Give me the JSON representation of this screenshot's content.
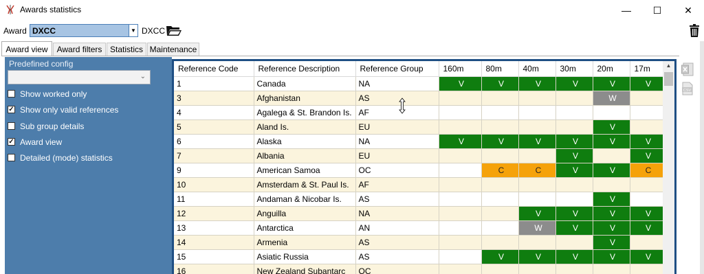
{
  "window": {
    "title": "Awards statistics",
    "minimize": "—",
    "maximize": "☐",
    "close": "✕"
  },
  "toolbar": {
    "award_label": "Award",
    "award_value": "DXCC",
    "award_suffix": "DXCC"
  },
  "tabs": [
    {
      "label": "Award view",
      "active": true
    },
    {
      "label": "Award filters",
      "active": false
    },
    {
      "label": "Statistics",
      "active": false
    },
    {
      "label": "Maintenance",
      "active": false
    }
  ],
  "left_panel": {
    "predefined_label": "Predefined config",
    "predefined_value": "",
    "options": [
      {
        "label": "Show worked only",
        "checked": false
      },
      {
        "label": "Show only valid references",
        "checked": true
      },
      {
        "label": "Sub group details",
        "checked": false
      },
      {
        "label": "Award view",
        "checked": true
      },
      {
        "label": "Detailed (mode) statistics",
        "checked": false
      }
    ]
  },
  "grid": {
    "columns": [
      "Reference Code",
      "Reference Description",
      "Reference Group",
      "160m",
      "80m",
      "40m",
      "30m",
      "20m",
      "17m"
    ],
    "rows": [
      {
        "code": "1",
        "desc": "Canada",
        "group": "NA",
        "marks": [
          "V",
          "V",
          "V",
          "V",
          "V",
          "V"
        ]
      },
      {
        "code": "3",
        "desc": "Afghanistan",
        "group": "AS",
        "marks": [
          "",
          "",
          "",
          "",
          "W",
          ""
        ]
      },
      {
        "code": "4",
        "desc": "Agalega & St. Brandon Is.",
        "group": "AF",
        "marks": [
          "",
          "",
          "",
          "",
          "",
          ""
        ]
      },
      {
        "code": "5",
        "desc": "Aland Is.",
        "group": "EU",
        "marks": [
          "",
          "",
          "",
          "",
          "V",
          ""
        ]
      },
      {
        "code": "6",
        "desc": "Alaska",
        "group": "NA",
        "marks": [
          "V",
          "V",
          "V",
          "V",
          "V",
          "V"
        ]
      },
      {
        "code": "7",
        "desc": "Albania",
        "group": "EU",
        "marks": [
          "",
          "",
          "",
          "V",
          "",
          "V"
        ]
      },
      {
        "code": "9",
        "desc": "American Samoa",
        "group": "OC",
        "marks": [
          "",
          "C",
          "C",
          "V",
          "V",
          "C"
        ]
      },
      {
        "code": "10",
        "desc": "Amsterdam & St. Paul Is.",
        "group": "AF",
        "marks": [
          "",
          "",
          "",
          "",
          "",
          ""
        ]
      },
      {
        "code": "11",
        "desc": "Andaman & Nicobar Is.",
        "group": "AS",
        "marks": [
          "",
          "",
          "",
          "",
          "V",
          ""
        ]
      },
      {
        "code": "12",
        "desc": "Anguilla",
        "group": "NA",
        "marks": [
          "",
          "",
          "V",
          "V",
          "V",
          "V"
        ]
      },
      {
        "code": "13",
        "desc": "Antarctica",
        "group": "AN",
        "marks": [
          "",
          "",
          "W",
          "V",
          "V",
          "V"
        ]
      },
      {
        "code": "14",
        "desc": "Armenia",
        "group": "AS",
        "marks": [
          "",
          "",
          "",
          "",
          "V",
          ""
        ]
      },
      {
        "code": "15",
        "desc": "Asiatic Russia",
        "group": "AS",
        "marks": [
          "",
          "V",
          "V",
          "V",
          "V",
          "V"
        ]
      },
      {
        "code": "16",
        "desc": "New Zealand Subantarc",
        "group": "OC",
        "marks": [
          "",
          "",
          "",
          "",
          "",
          ""
        ]
      }
    ]
  },
  "colors": {
    "confirmed": "#0f7d0f",
    "card": "#f5a20a",
    "worked": "#8c8c8c",
    "panel": "#4d7dab",
    "row_alt": "#fbf4dd"
  },
  "icons": [
    "app-icon",
    "folder-open-icon",
    "trash-icon",
    "excel-export-icon",
    "csv-export-icon"
  ]
}
